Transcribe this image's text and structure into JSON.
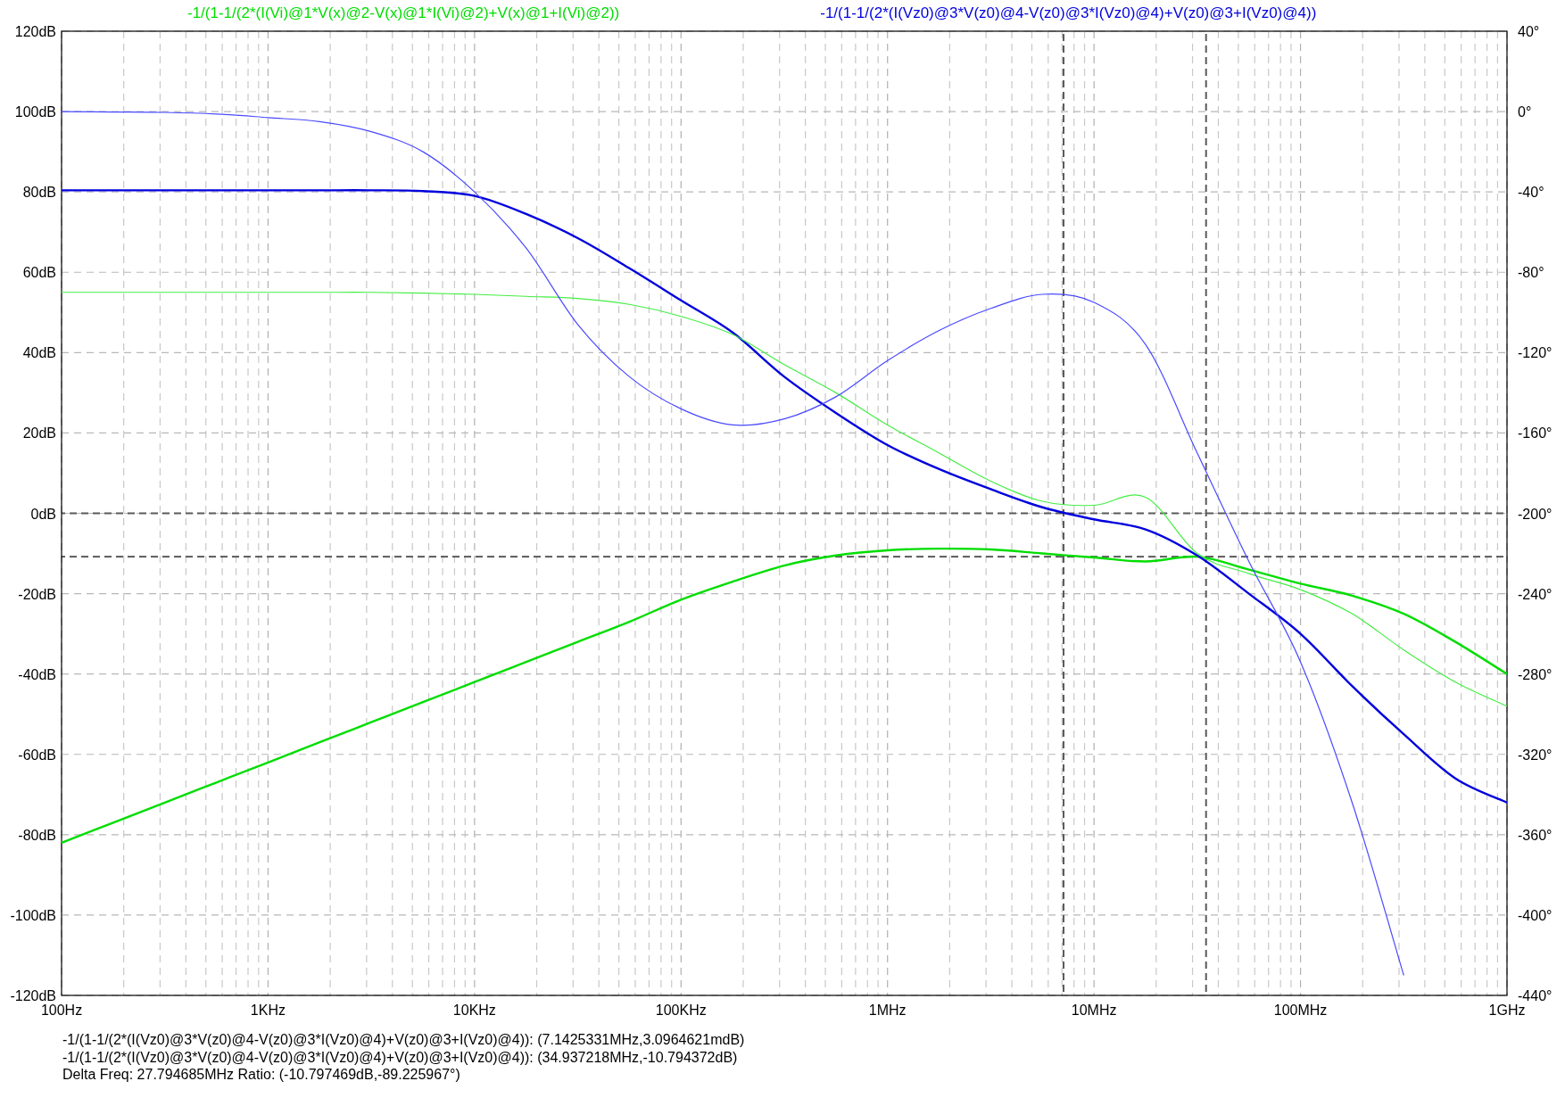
{
  "plot": {
    "chart_data": {
      "type": "line",
      "categories": [
        "100Hz",
        null,
        null,
        null,
        "1KHz",
        null,
        null,
        null,
        "10KHz",
        null,
        null,
        null,
        "100KHz",
        null,
        null,
        null,
        "1MHz",
        null,
        null,
        null,
        "10MHz",
        null,
        null,
        null,
        "100MHz",
        null,
        null,
        null,
        "1GHz"
      ],
      "ylim": [
        -120,
        120
      ],
      "yticks": [
        {
          "value": 120,
          "label": "120dB"
        },
        {
          "value": 100,
          "label": "100dB"
        },
        {
          "value": 80,
          "label": "80dB"
        },
        {
          "value": 60,
          "label": "60dB"
        },
        {
          "value": 40,
          "label": "40dB"
        },
        {
          "value": 20,
          "label": "20dB"
        },
        {
          "value": 0,
          "label": "0dB"
        },
        {
          "value": -20,
          "label": "-20dB"
        },
        {
          "value": -40,
          "label": "-40dB"
        },
        {
          "value": -60,
          "label": "-60dB"
        },
        {
          "value": -80,
          "label": "-80dB"
        },
        {
          "value": -100,
          "label": "-100dB"
        },
        {
          "value": -120,
          "label": "-120dB"
        }
      ],
      "series": [
        {
          "name": "-1/(1-1/(2*(I(Vi)@1*V(x)@2-V(x)@1*I(Vi)@2)+V(x)@1+I(Vi)@2))",
          "color": "#00dd00",
          "values": [
            -82,
            -77,
            -72,
            -67,
            -62,
            -57,
            -52,
            -47,
            -42,
            -37,
            -32,
            -27,
            -21.5,
            -17,
            -13,
            -10.5,
            -9.2,
            -8.8,
            -9,
            -10,
            -11,
            -12,
            -10.8,
            -14,
            -17.5,
            -20.5,
            -25,
            -32,
            -40
          ]
        },
        {
          "name": "-1/(1-1/(2*(I(Vz0)@3*V(z0)@4-V(z0)@3*I(Vz0)@4)+V(z0)@3+I(Vz0)@4))",
          "color": "#0000dd",
          "values": [
            80.4,
            80.4,
            80.4,
            80.4,
            80.4,
            80.4,
            80.4,
            80.2,
            79,
            74.5,
            68.5,
            61,
            53,
            45,
            34,
            25,
            17,
            11,
            6,
            1.5,
            -1.5,
            -4,
            -10.5,
            -20,
            -30,
            -43,
            -55,
            -66,
            -72
          ]
        }
      ],
      "grid": true,
      "ref_lines": [
        {
          "axis": "y",
          "value": 0.0031
        },
        {
          "axis": "y",
          "value": -10.794372
        }
      ]
    },
    "cursors": [
      {
        "level": 0.6932
      },
      {
        "level": 0.7918
      }
    ],
    "phase": {
      "chart_data": {
        "type": "line",
        "categories": [
          null,
          null,
          null,
          null,
          null,
          null,
          null,
          null,
          null,
          null,
          null,
          null,
          null,
          null,
          null,
          null,
          null,
          null,
          null,
          null,
          null,
          null,
          null,
          null,
          null,
          null,
          null,
          null,
          null
        ],
        "ylim": [
          -440,
          40
        ],
        "yticks": [
          {
            "value": 40,
            "label": "40°"
          },
          {
            "value": 0,
            "label": "0°"
          },
          {
            "value": -40,
            "label": "-40°"
          },
          {
            "value": -80,
            "label": "-80°"
          },
          {
            "value": -120,
            "label": "-120°"
          },
          {
            "value": -160,
            "label": "-160°"
          },
          {
            "value": -200,
            "label": "-200°"
          },
          {
            "value": -240,
            "label": "-240°"
          },
          {
            "value": -280,
            "label": "-280°"
          },
          {
            "value": -320,
            "label": "-320°"
          },
          {
            "value": -360,
            "label": "-360°"
          },
          {
            "value": -400,
            "label": "-400°"
          },
          {
            "value": -440,
            "label": "-440°"
          }
        ],
        "series": [
          {
            "color": "#44ee44",
            "values": [
              -90,
              -90,
              -90,
              -90,
              -90,
              -90,
              -90,
              -90.4,
              -91,
              -92,
              -93,
              -96,
              -102,
              -111,
              -126,
              -140,
              -156,
              -170,
              -184,
              -194,
              -196,
              -192,
              -220,
              -230,
              -238,
              -250,
              -268,
              -284,
              -296
            ]
          },
          {
            "color": "#4a4aff",
            "values": [
              0,
              -0.2,
              -0.4,
              -1.2,
              -3,
              -5,
              -10,
              -20,
              -40,
              -68,
              -106,
              -132,
              -148,
              -156,
              -153,
              -142,
              -124,
              -109,
              -98,
              -91,
              -95,
              -116,
              -170,
              -224,
              -274,
              -344,
              -430,
              null,
              null
            ]
          }
        ]
      }
    }
  },
  "cursor_readouts": [
    "-1/(1-1/(2*(I(Vz0)@3*V(z0)@4-V(z0)@3*I(Vz0)@4)+V(z0)@3+I(Vz0)@4)): (7.1425331MHz,3.0964621mdB)",
    "-1/(1-1/(2*(I(Vz0)@3*V(z0)@4-V(z0)@3*I(Vz0)@4)+V(z0)@3+I(Vz0)@4)): (34.937218MHz,-10.794372dB)",
    "Delta Freq: 27.794685MHz Ratio: (-10.797469dB,-89.225967°)"
  ]
}
